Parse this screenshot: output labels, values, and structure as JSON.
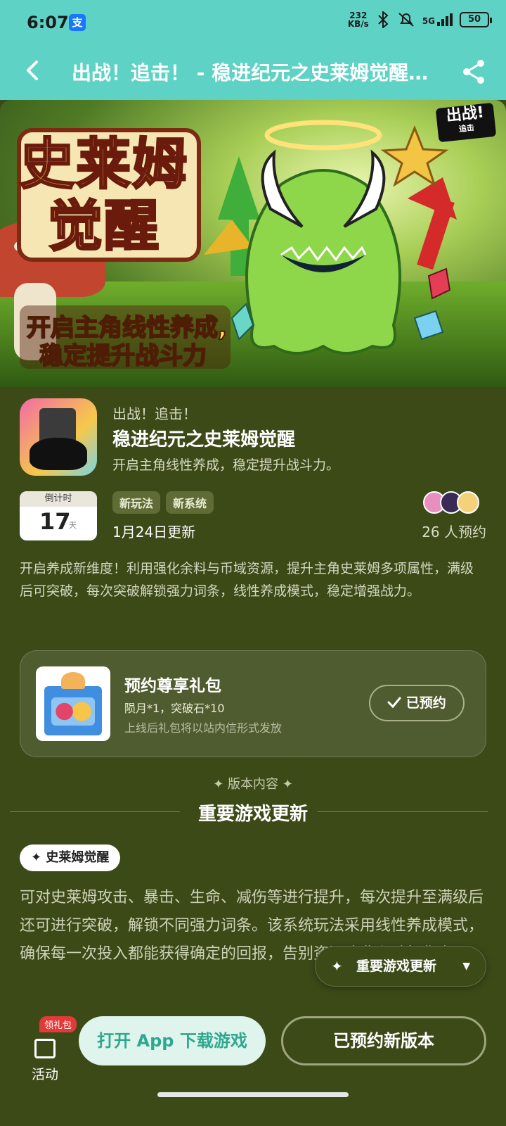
{
  "status_bar": {
    "time": "6:07",
    "net_speed": "232\nKB/s",
    "net_speed_value": "232",
    "net_speed_unit": "KB/s",
    "network": "5G",
    "battery": "50"
  },
  "nav": {
    "title": "出战！追击！ - 稳进纪元之史莱姆觉醒…"
  },
  "banner": {
    "logo_line1": "史莱姆",
    "logo_line2": "觉醒",
    "slogan_line1": "开启主角线性养成,",
    "slogan_line2": "稳定提升战斗力",
    "corner_logo": "出战!",
    "corner_logo_sub": "追击"
  },
  "app": {
    "series": "出战！追击！",
    "name": "稳进纪元之史莱姆觉醒",
    "tagline": "开启主角线性养成，稳定提升战斗力。"
  },
  "countdown": {
    "label": "倒计时",
    "value": "17",
    "unit": "天"
  },
  "tags": [
    "新玩法",
    "新系统"
  ],
  "updated": "1月24日更新",
  "reservations": "26 人预约",
  "description": "开启养成新维度！利用强化余料与币域资源，提升主角史莱姆多项属性，满级后可突破，每次突破解锁强力词条，线性养成模式，稳定增强战力。",
  "gift": {
    "title": "预约尊享礼包",
    "items": "陨月*1，突破石*10",
    "note": "上线后礼包将以站内信形式发放",
    "button": "已预约"
  },
  "section": {
    "small": "✦ 版本内容 ✦",
    "big": "重要游戏更新"
  },
  "feature": {
    "chip": "史莱姆觉醒",
    "text": "可对史莱姆攻击、暴击、生命、减伤等进行提升，每次提升至满级后还可进行突破，解锁不同强力词条。该系统玩法采用线性养成模式，确保每一次投入都能获得确定的回报，告别资源浪费和随机焦虑。"
  },
  "floating_nav": {
    "label": "重要游戏更新"
  },
  "bottom": {
    "activity_label": "活动",
    "activity_badge": "领礼包",
    "open_button": "打开 App 下载游戏",
    "reserved_button": "已预约新版本"
  },
  "colors": {
    "header": "#5fd2c6",
    "background": "#3c4a18",
    "open_button_bg": "#dff4ec",
    "open_button_text": "#2fa88f"
  },
  "icons": [
    "back-icon",
    "share-icon",
    "bluetooth-icon",
    "mute-icon",
    "check-icon",
    "sparkle-icon",
    "caret-down-icon",
    "gift-icon"
  ]
}
